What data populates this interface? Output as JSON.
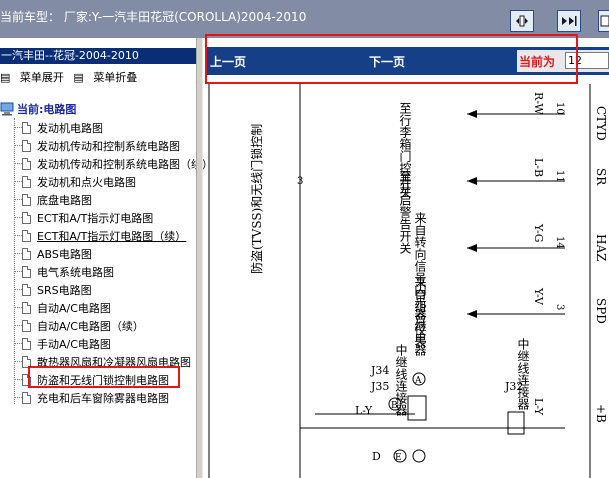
{
  "window": {
    "title": "当前车型：  厂家:Y-一汽丰田花冠(COROLLA)2004-2010"
  },
  "toolbar": {
    "buttons": [
      "single-page-icon",
      "fit-page-icon",
      "page-view-icon"
    ]
  },
  "sidebar": {
    "model": "一汽丰田--花冠-2004-2010",
    "expand_label": "菜单展开",
    "collapse_label": "菜单折叠",
    "menu_icon": "▤",
    "root_label": "当前:电路图",
    "items": [
      {
        "label": "发动机电路图"
      },
      {
        "label": "发动机传动和控制系统电路图"
      },
      {
        "label": "发动机传动和控制系统电路图（续）"
      },
      {
        "label": "发动机和点火电路图"
      },
      {
        "label": "底盘电路图"
      },
      {
        "label": "ECT和A/T指示灯电路图"
      },
      {
        "label": "ECT和A/T指示灯电路图（续）"
      },
      {
        "label": "ABS电路图"
      },
      {
        "label": "电气系统电路图"
      },
      {
        "label": "SRS电路图"
      },
      {
        "label": "自动A/C电路图"
      },
      {
        "label": "自动A/C电路图（续）"
      },
      {
        "label": "手动A/C电路图"
      },
      {
        "label": "散热器风扇和冷凝器风扇电路图"
      },
      {
        "label": "防盗和无线门锁控制电路图"
      },
      {
        "label": "充电和后车窗除雾器电路图"
      }
    ]
  },
  "nav": {
    "prev_label": "上一页",
    "next_label": "下一页",
    "current_label": "当前为",
    "current_page": "12"
  },
  "diagram": {
    "title": "防盗(TVSS)和无线门锁控制",
    "wires": [
      "R-W",
      "L-B",
      "Y-G",
      "Y-V",
      "L-Y"
    ],
    "pins": [
      "10",
      "11",
      "14",
      "3",
      "3"
    ],
    "signals": [
      "CTYD",
      "SR",
      "HAZ",
      "SPD",
      "+B"
    ],
    "labels": {
      "door_switch": "至行李箱门控开关",
      "start_switch": "至开启警告开关",
      "turn_relay": "来自转向信号闪光器继电器",
      "meter": "来自组合仪表",
      "j34": "J34",
      "j35": "J35",
      "relay_conn": "中继线连接器",
      "j32": "J32",
      "relay_conn2": "中继线连接器",
      "a": "A",
      "b": "B",
      "e": "E",
      "d": "D",
      "ly": "L-Y",
      "tick3": "3"
    }
  },
  "colors": {
    "titlebar": "#828ca4",
    "model_bar": "#0a2e76",
    "nav_bar": "#153f86",
    "highlight": "#e21818",
    "root_text": "#1a2a9a"
  }
}
